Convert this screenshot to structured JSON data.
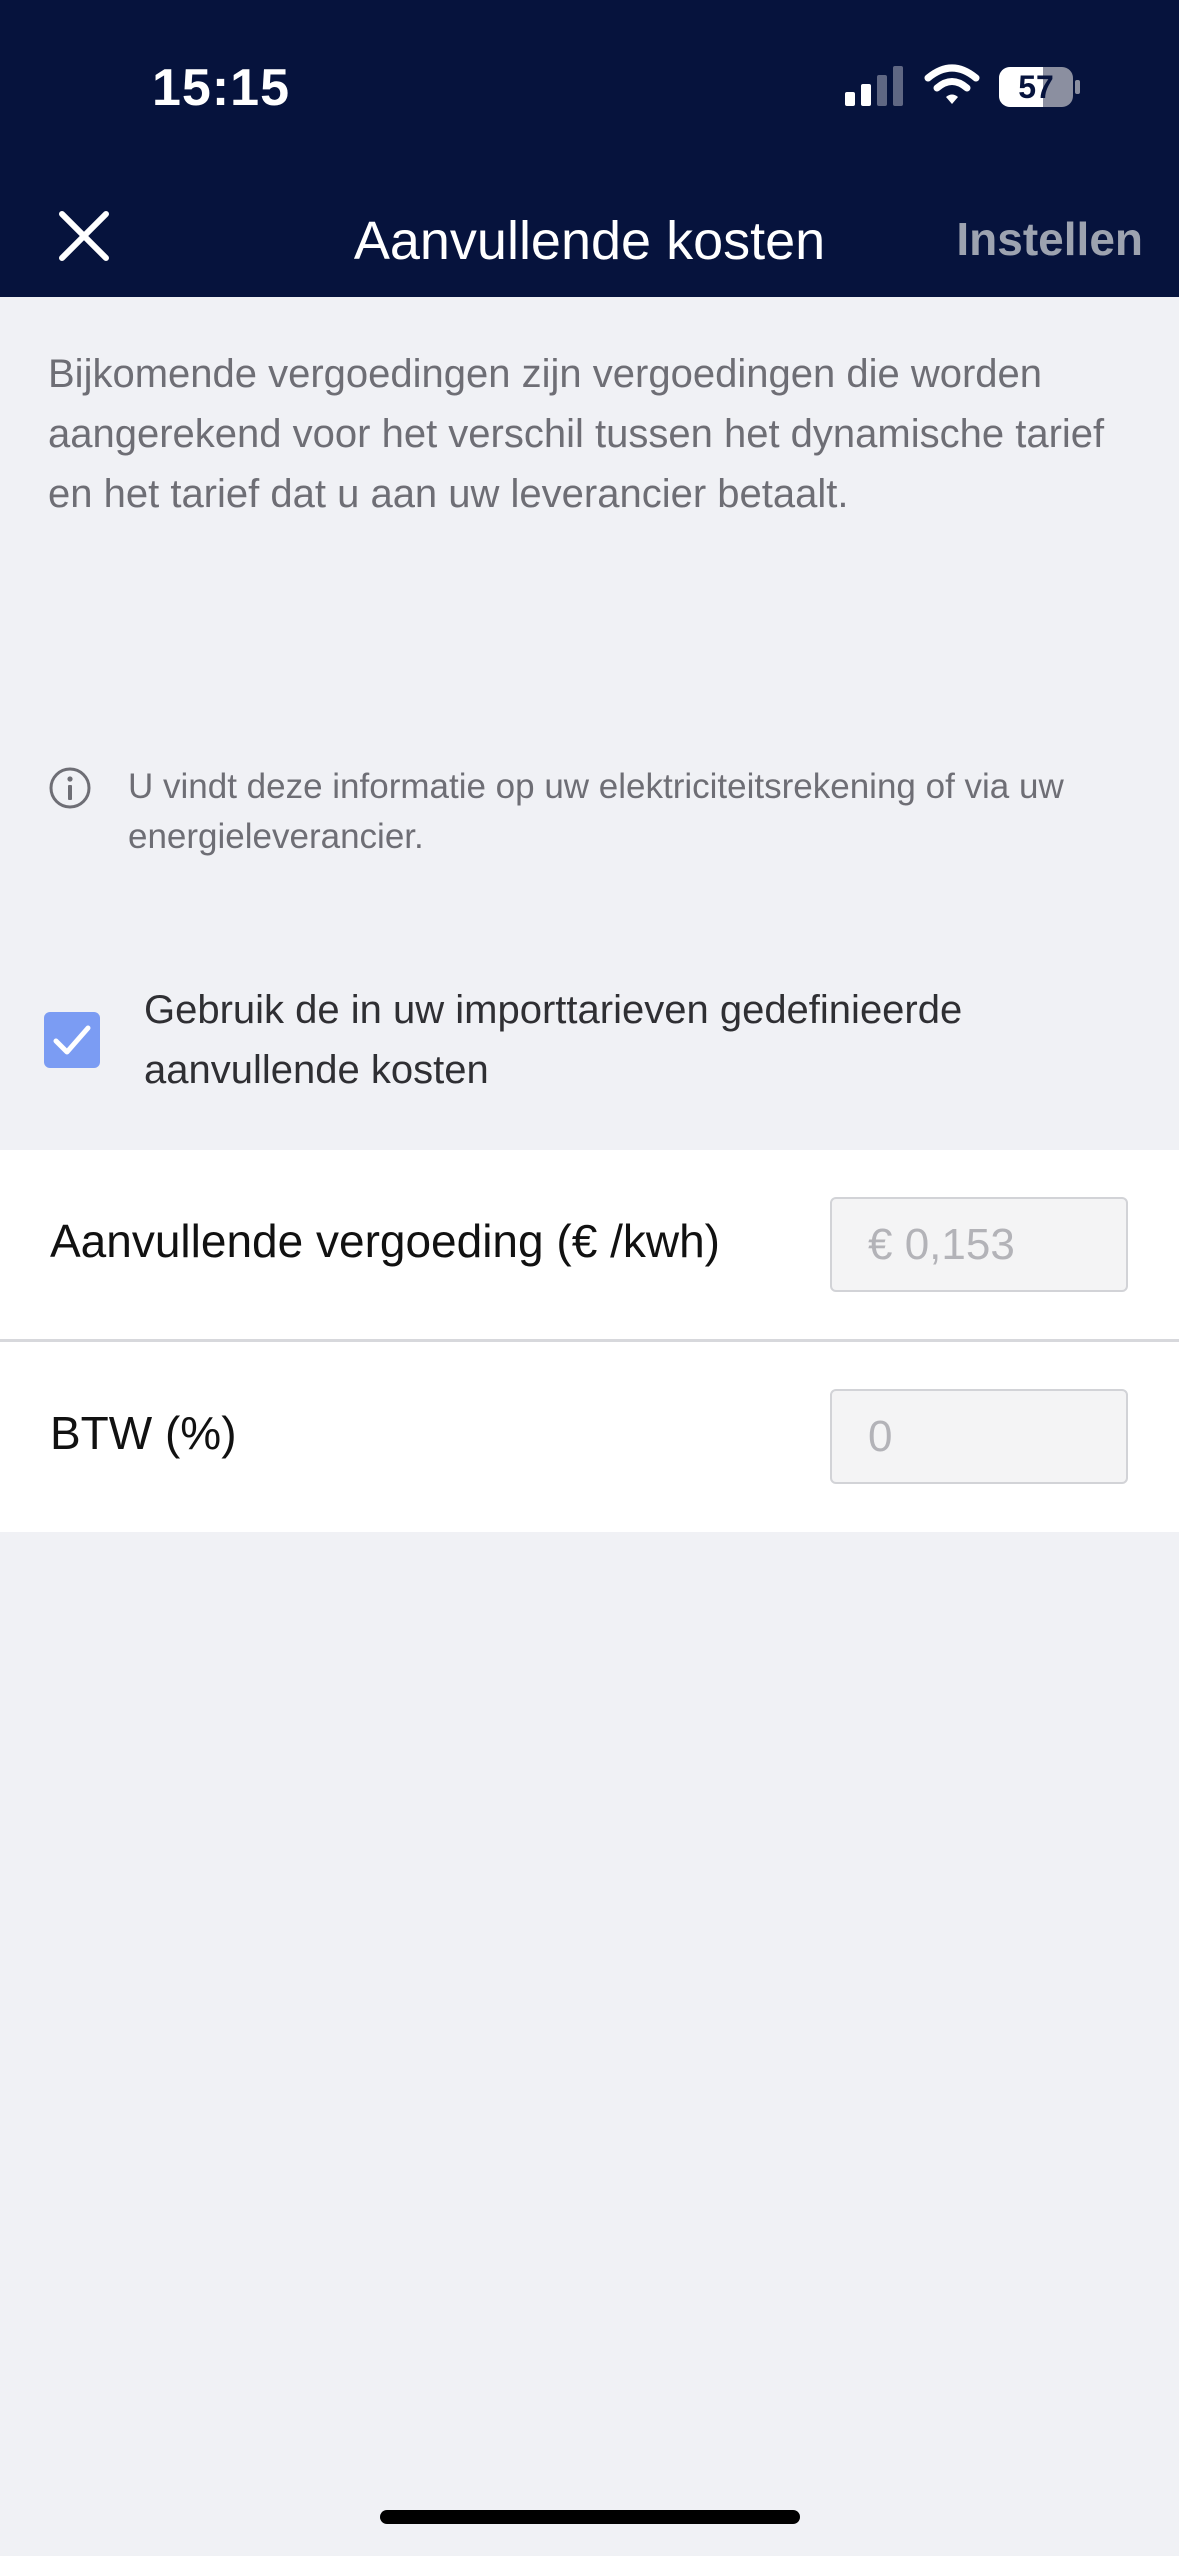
{
  "status_bar": {
    "time": "15:15",
    "battery": "57"
  },
  "nav": {
    "title": "Aanvullende kosten",
    "action_label": "Instellen",
    "close_icon": "close-icon"
  },
  "description": "Bijkomende vergoedingen zijn vergoedingen die worden aangerekend voor het verschil tussen het dynamische tarief en het tarief dat u aan uw leverancier betaalt.",
  "info": {
    "icon": "info-icon",
    "text": "U vindt deze informatie op uw elektriciteitsrekening of via uw energieleverancier."
  },
  "checkbox": {
    "checked": true,
    "label": "Gebruik de in uw importtarieven gedefinieerde aanvullende kosten"
  },
  "form": {
    "fee": {
      "label": "Aanvullende vergoeding (€ /kwh)",
      "value": "€ 0,153"
    },
    "vat": {
      "label": "BTW (%)",
      "value": "0"
    }
  },
  "colors": {
    "header_bg": "#06133d",
    "page_bg": "#f0f1f5",
    "checkbox_accent": "#7b9cf3",
    "action_disabled": "#9da3b0"
  }
}
